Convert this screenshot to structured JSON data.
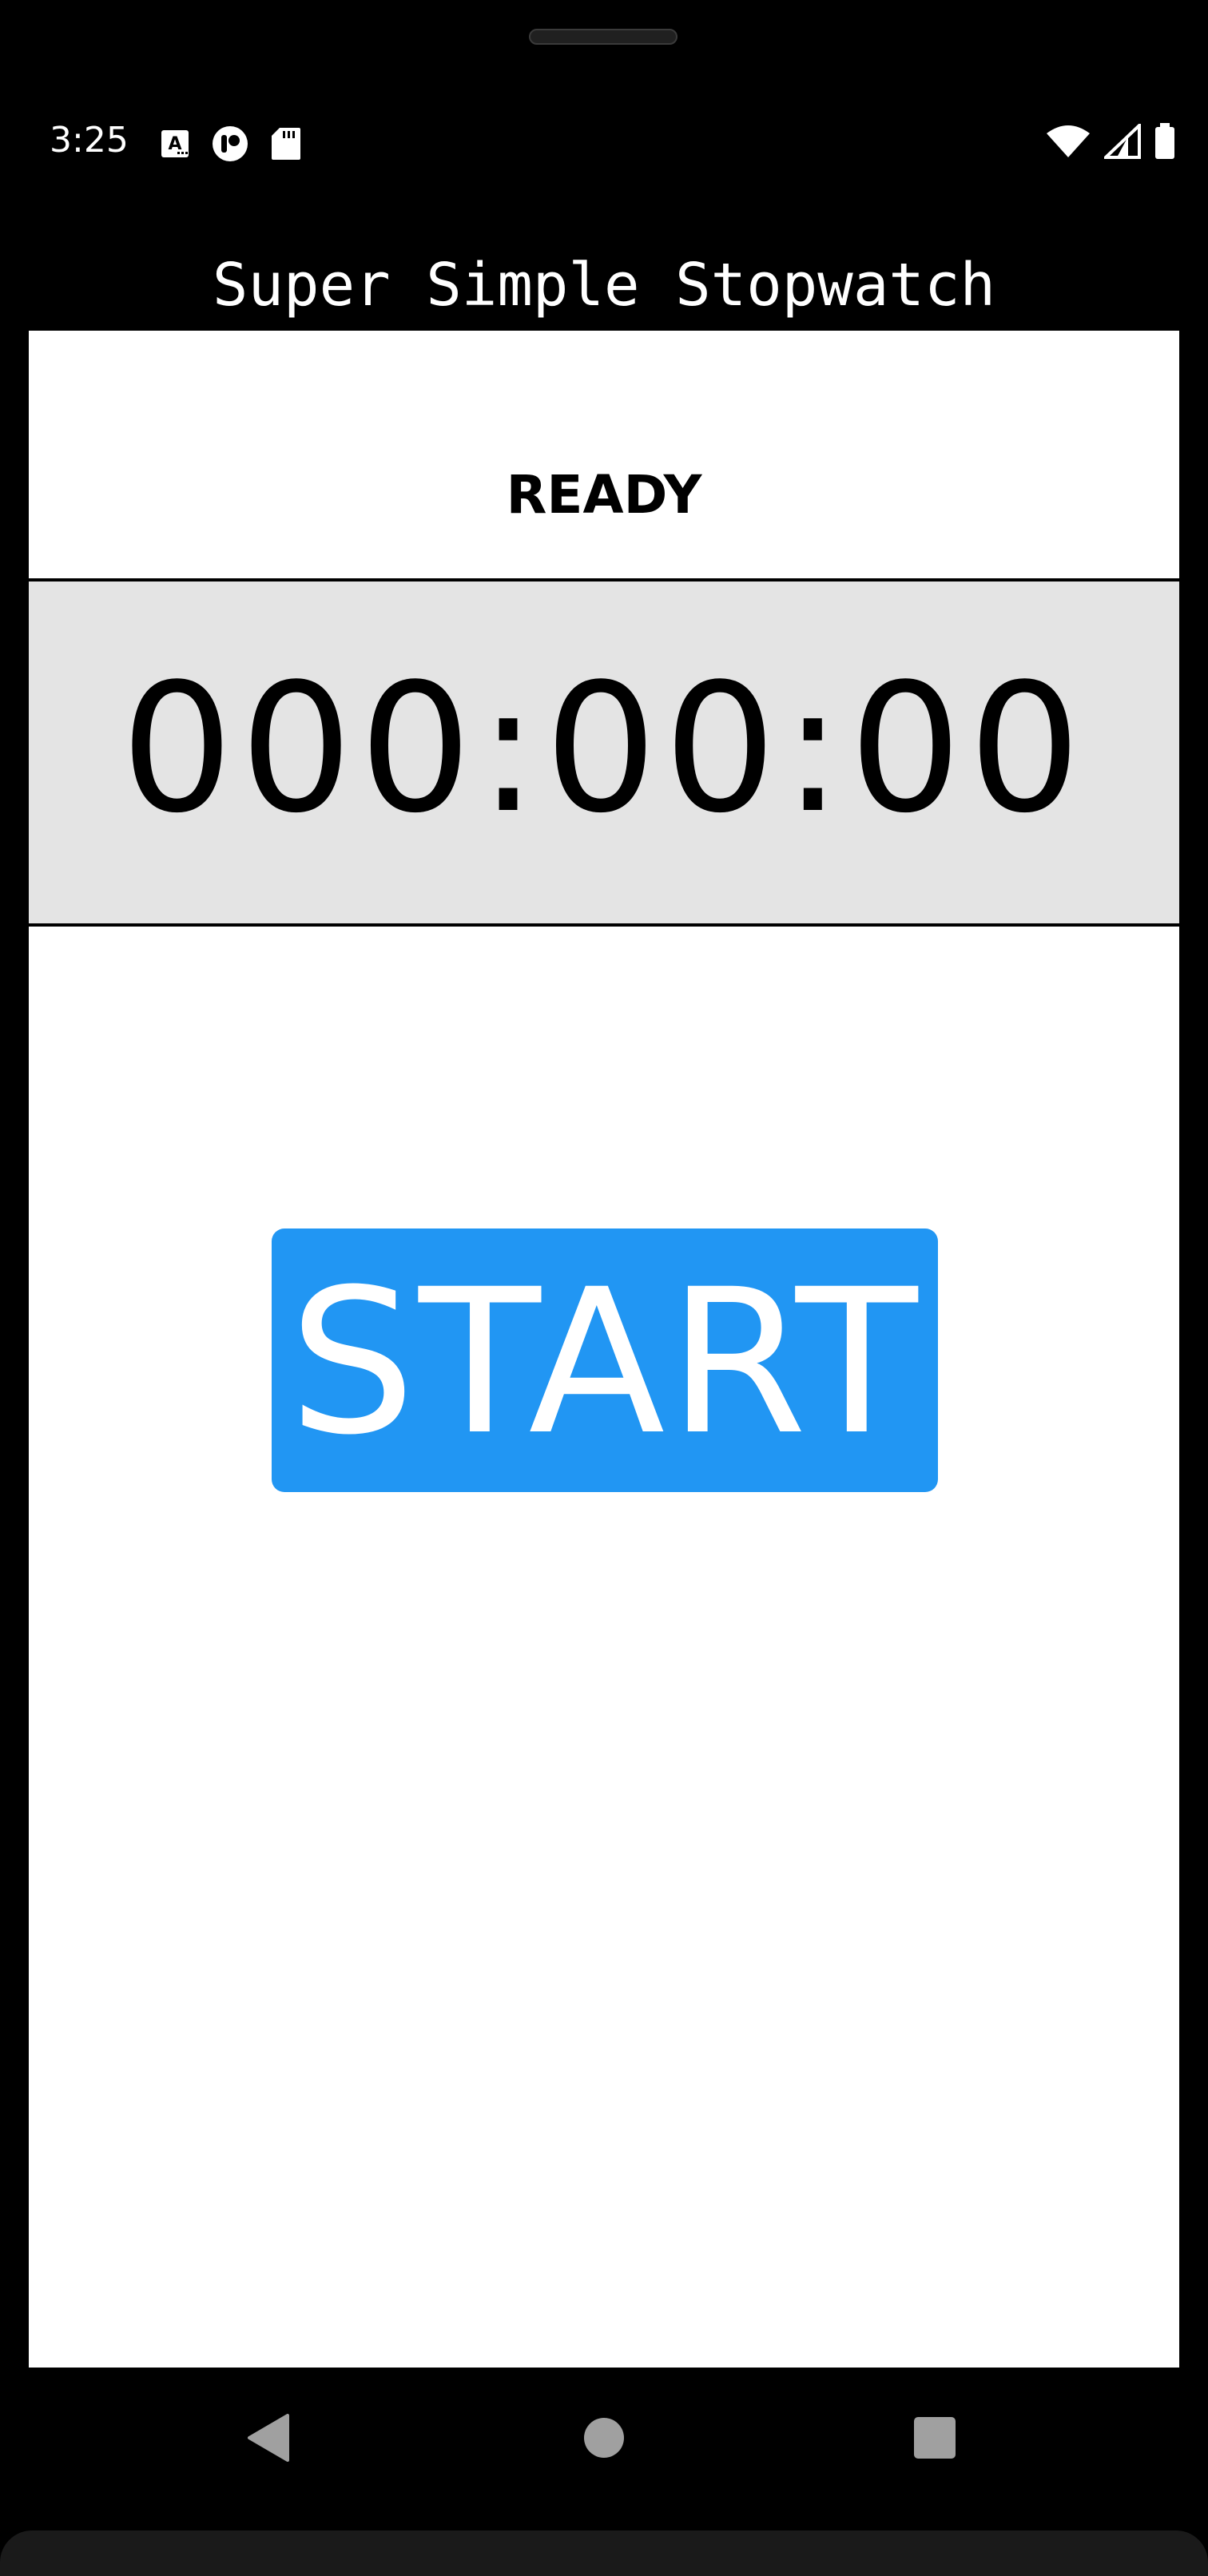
{
  "status_bar": {
    "time": "3:25",
    "left_icons": [
      "font-download-icon",
      "app-notification-icon",
      "sd-card-icon"
    ],
    "right_icons": [
      "wifi-icon",
      "cellular-signal-icon",
      "battery-icon"
    ]
  },
  "app": {
    "title": "Super Simple Stopwatch"
  },
  "stopwatch": {
    "state_label": "READY",
    "time_display": "000:00:00",
    "start_button_label": "START"
  },
  "navigation": {
    "buttons": [
      "back-icon",
      "home-icon",
      "recents-icon"
    ]
  },
  "colors": {
    "background": "#000000",
    "screen": "#ffffff",
    "timer_panel": "#e4e4e4",
    "accent": "#2196f3",
    "nav_icon": "#a0a0a0"
  }
}
